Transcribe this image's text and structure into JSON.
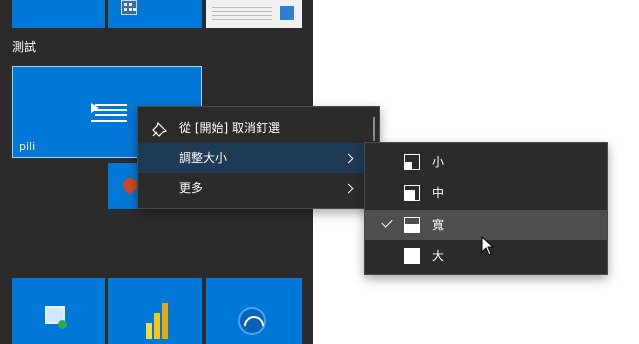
{
  "start": {
    "group_title": "測試",
    "pili_tile_label": "pili"
  },
  "context_menu": {
    "unpin_label": "從 [開始] 取消釘選",
    "resize_label": "調整大小",
    "more_label": "更多"
  },
  "resize_menu": {
    "items": [
      {
        "label": "小",
        "checked": false
      },
      {
        "label": "中",
        "checked": false
      },
      {
        "label": "寬",
        "checked": true
      },
      {
        "label": "大",
        "checked": false
      }
    ]
  },
  "icons": [
    "calculator-icon",
    "photo-icon",
    "menu-lines-icon",
    "map-pin-icon",
    "remote-desktop-icon",
    "power-bi-icon",
    "wifi-icon",
    "unpin-icon",
    "chevron-right-icon",
    "checkmark-icon",
    "tile-size-small-icon",
    "tile-size-medium-icon",
    "tile-size-wide-icon",
    "tile-size-large-icon",
    "mouse-pointer-icon"
  ],
  "colors": {
    "tile_blue": "#0078d7",
    "start_bg": "#2b2b2b",
    "menu_active": "#1f3a55",
    "menu_hover": "#4e4e4e"
  }
}
